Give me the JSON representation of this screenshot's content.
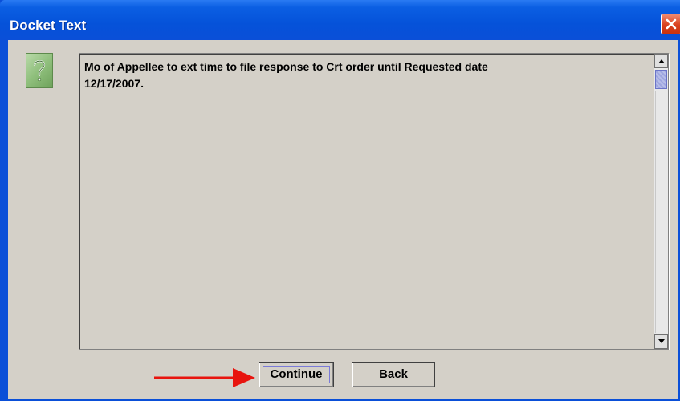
{
  "window": {
    "title": "Docket Text",
    "close_icon": "close-icon"
  },
  "dialog": {
    "icon": "question-icon",
    "icon_glyph": "?",
    "message": "Mo of Appellee to ext time to file response to Crt order until Requested date\n12/17/2007."
  },
  "buttons": {
    "continue_label": "Continue",
    "back_label": "Back"
  },
  "annotation": {
    "type": "red-arrow-pointing-right",
    "color": "#e8140e"
  },
  "colors": {
    "titlebar": "#0a4fd8",
    "dialog_bg": "#d4d0c8",
    "close_button": "#d9411f"
  }
}
